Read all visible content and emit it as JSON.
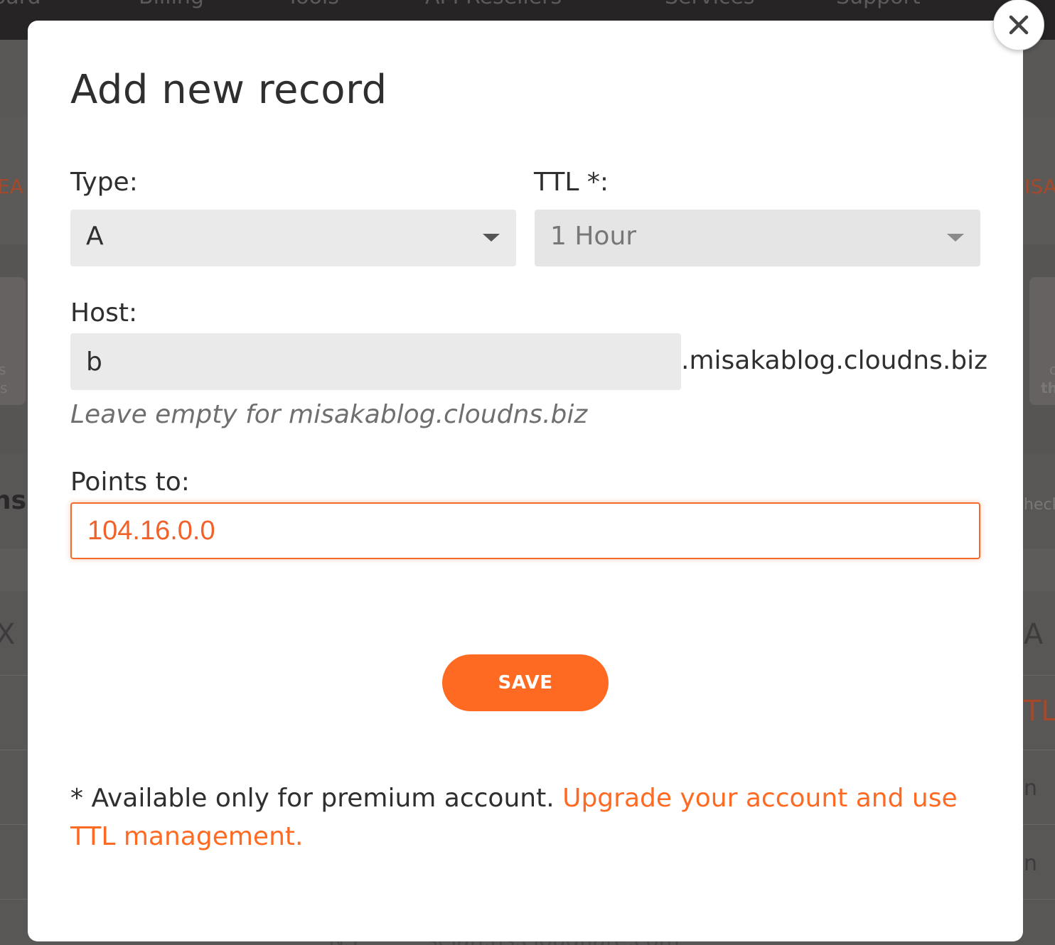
{
  "background": {
    "nav_items": [
      "oard",
      "Billing",
      "Tools",
      "API Resellers",
      "Services",
      "Support"
    ],
    "left_fragments": [
      "EA",
      "s",
      "s",
      "ns.",
      "X"
    ],
    "right_fragments": [
      "ISA",
      "c",
      "th",
      "heck",
      "A",
      "TL",
      "n",
      "n"
    ],
    "bottom_fragments": [
      "NS",
      "sejan.ns.cloudflare.com"
    ]
  },
  "modal": {
    "title": "Add new record",
    "type_label": "Type:",
    "type_value": "A",
    "ttl_label": "TTL *:",
    "ttl_value": "1 Hour",
    "host_label": "Host:",
    "host_value": "b",
    "host_suffix": ".misakablog.cloudns.biz",
    "host_hint": "Leave empty for misakablog.cloudns.biz",
    "points_label": "Points to:",
    "points_value": "104.16.0.0",
    "save_label": "SAVE",
    "note_text": "* Available only for premium account.",
    "note_link": "Upgrade your account and use TTL management."
  },
  "colors": {
    "accent": "#ff6a22",
    "overlay": "#595656",
    "field_bg": "#eaeaea"
  },
  "icons": {
    "close": "close-icon",
    "type_caret": "chevron-down-icon",
    "ttl_caret": "chevron-down-icon"
  }
}
